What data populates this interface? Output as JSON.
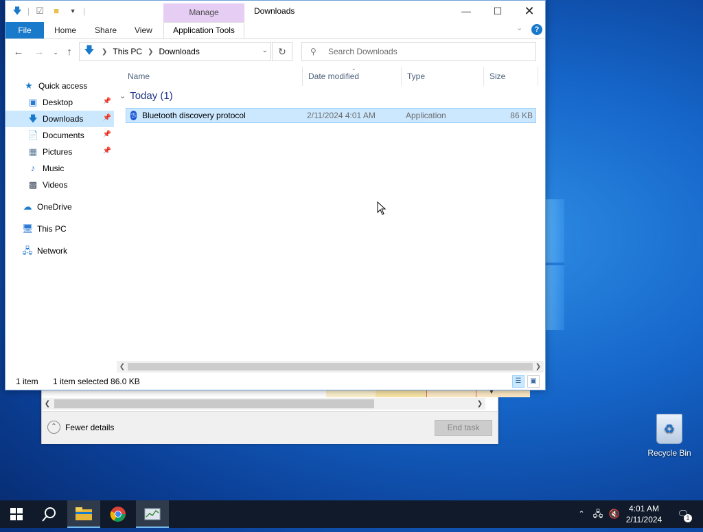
{
  "task_manager": {
    "fewer_details": "Fewer details",
    "end_task": "End task"
  },
  "explorer": {
    "window_title": "Downloads",
    "context_tab": "Manage",
    "ribbon_tabs": [
      "File",
      "Home",
      "Share",
      "View",
      "Application Tools"
    ],
    "breadcrumb": [
      "This PC",
      "Downloads"
    ],
    "search_placeholder": "Search Downloads",
    "nav": {
      "quick_access": "Quick access",
      "items": [
        "Desktop",
        "Downloads",
        "Documents",
        "Pictures",
        "Music",
        "Videos"
      ],
      "onedrive": "OneDrive",
      "this_pc": "This PC",
      "network": "Network"
    },
    "columns": [
      "Name",
      "Date modified",
      "Type",
      "Size"
    ],
    "group": "Today (1)",
    "file": {
      "name": "Bluetooth discovery protocol",
      "date": "2/11/2024 4:01 AM",
      "type": "Application",
      "size": "86 KB"
    },
    "status": {
      "count": "1 item",
      "selected": "1 item selected  86.0 KB"
    }
  },
  "desktop": {
    "recycle_bin": "Recycle Bin"
  },
  "taskbar": {
    "time": "4:01 AM",
    "date": "2/11/2024",
    "notification_count": "1"
  }
}
